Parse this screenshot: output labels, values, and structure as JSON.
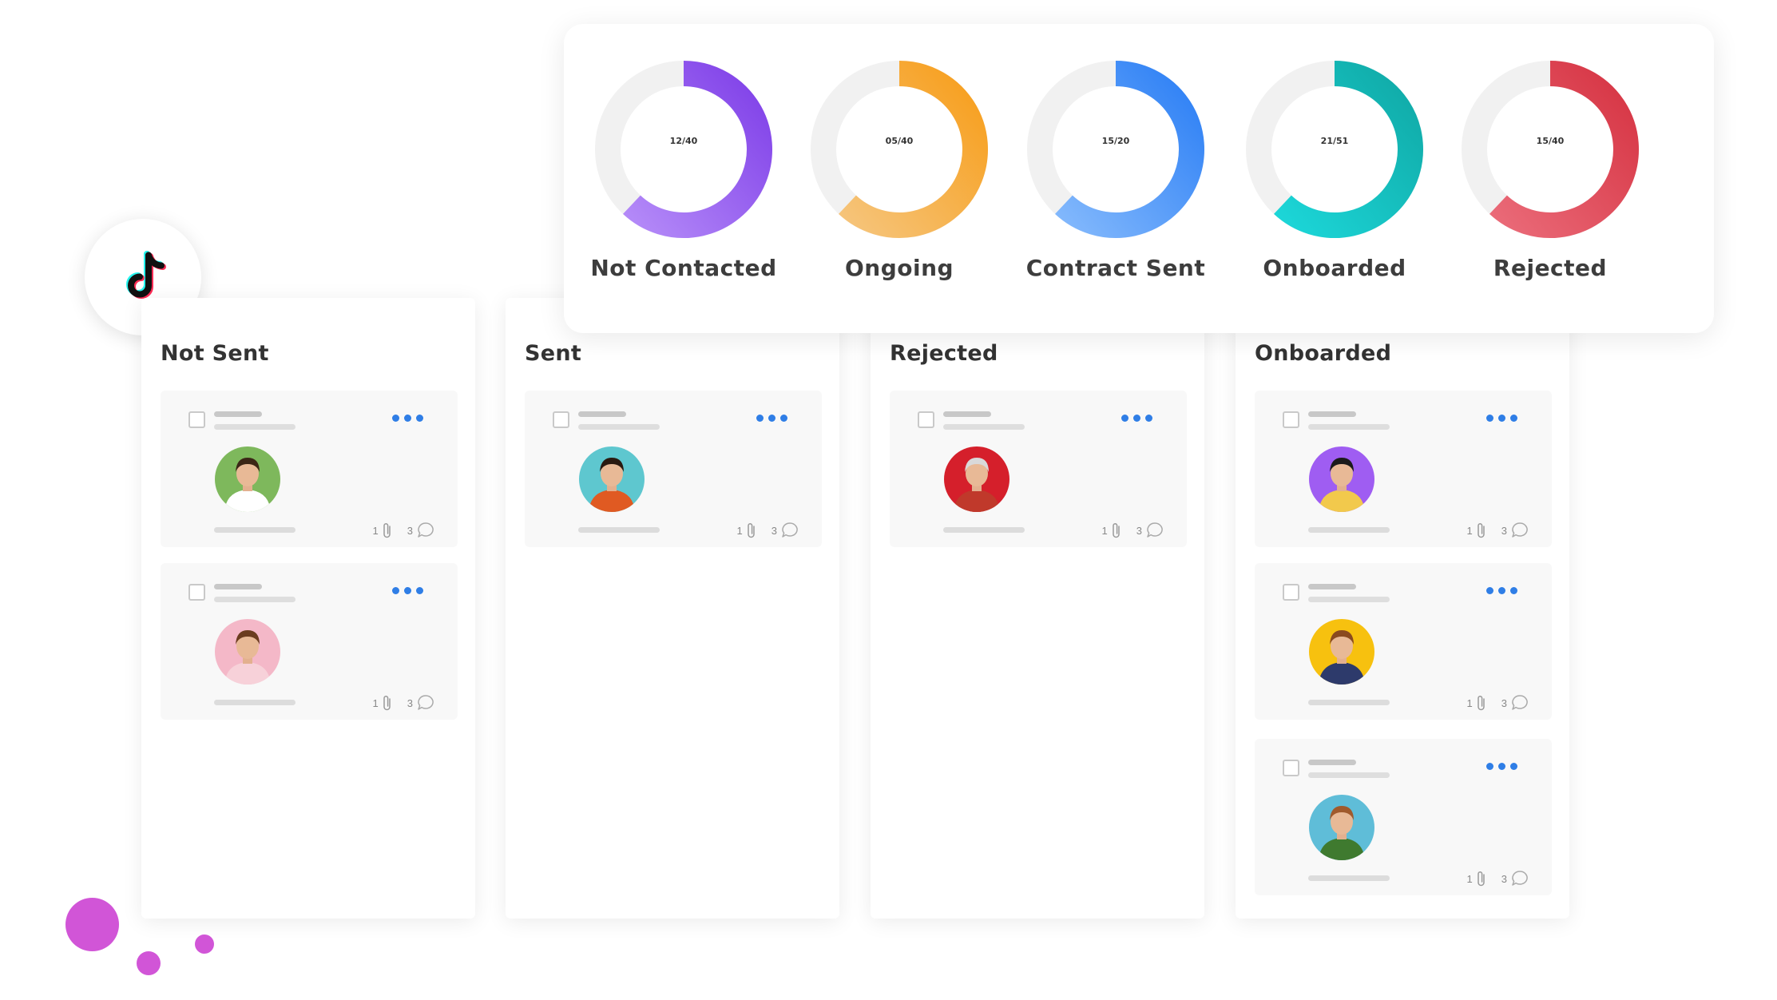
{
  "stats": {
    "items": [
      {
        "label": "Not Contacted",
        "count": "12/40",
        "value": 12,
        "total": 40,
        "colors": [
          "#7f3fe8",
          "#b48af8"
        ]
      },
      {
        "label": "Ongoing",
        "count": "05/40",
        "value": 5,
        "total": 40,
        "colors": [
          "#f79e1b",
          "#f6c47a"
        ]
      },
      {
        "label": "Contract Sent",
        "count": "15/20",
        "value": 15,
        "total": 20,
        "colors": [
          "#2c7ff5",
          "#82b8fc"
        ]
      },
      {
        "label": "Onboarded",
        "count": "21/51",
        "value": 21,
        "total": 51,
        "colors": [
          "#10a9a6",
          "#1cd6d8"
        ]
      },
      {
        "label": "Rejected",
        "count": "15/40",
        "value": 15,
        "total": 40,
        "colors": [
          "#d63443",
          "#ea6a78"
        ]
      }
    ],
    "track_color": "#f1f1f1"
  },
  "columns": [
    {
      "title": "Not Sent",
      "cards": [
        {
          "attachments": "1",
          "comments": "3",
          "avatar_bg": "#7eb85c"
        },
        {
          "attachments": "1",
          "comments": "3",
          "avatar_bg": "#f4b8c8"
        }
      ]
    },
    {
      "title": "Sent",
      "cards": [
        {
          "attachments": "1",
          "comments": "3",
          "avatar_bg": "#5ec7cf"
        }
      ]
    },
    {
      "title": "Rejected",
      "cards": [
        {
          "attachments": "1",
          "comments": "3",
          "avatar_bg": "#d51f2b"
        }
      ]
    },
    {
      "title": "Onboarded",
      "cards": [
        {
          "attachments": "1",
          "comments": "3",
          "avatar_bg": "#9f5df2"
        },
        {
          "attachments": "1",
          "comments": "3",
          "avatar_bg": "#f7c10f"
        },
        {
          "attachments": "1",
          "comments": "3",
          "avatar_bg": "#5fbdd8"
        }
      ]
    }
  ],
  "brand": {
    "logo": "tiktok-icon",
    "accent": "#2f7ee6",
    "decoration": "#d155d7"
  }
}
